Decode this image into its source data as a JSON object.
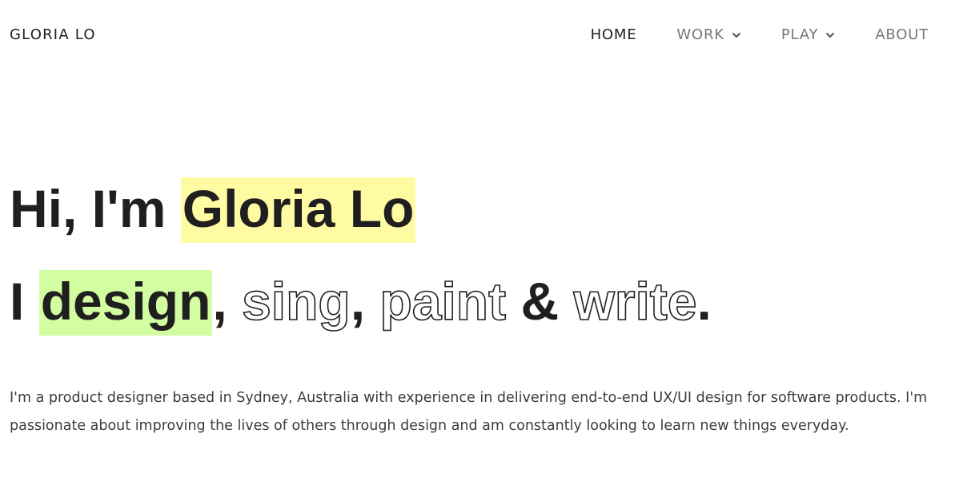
{
  "brand": "GLORIA LO",
  "nav": {
    "home": "HOME",
    "work": "WORK",
    "play": "PLAY",
    "about": "ABOUT"
  },
  "hero": {
    "line1_prefix": "Hi, I'm ",
    "line1_name": "Gloria Lo",
    "line2_prefix": "I ",
    "line2_design": "design",
    "line2_comma1": ", ",
    "line2_sing": "sing",
    "line2_comma2": ", ",
    "line2_paint": "paint",
    "line2_amp": " & ",
    "line2_write": "write",
    "line2_period": "."
  },
  "intro": "I'm a product designer based in Sydney, Australia with experience in delivering end-to-end UX/UI design for software products. I'm passionate about improving the lives of others through design and am constantly looking to learn new things everyday.",
  "colors": {
    "highlight_yellow": "#fffba3",
    "highlight_green": "#d2fda0",
    "text_dark": "#1f1f1f",
    "nav_muted": "#777777"
  },
  "icons": {
    "dropdown": "chevron-down-icon"
  }
}
